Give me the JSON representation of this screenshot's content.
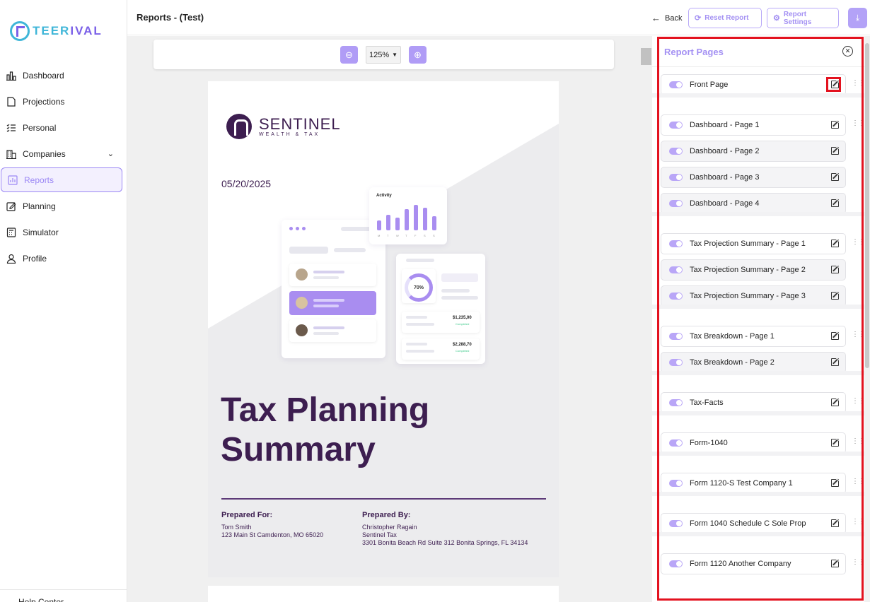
{
  "brand": {
    "name_a": "TEER",
    "name_b": "IVAL"
  },
  "sidebar": {
    "items": [
      {
        "label": "Dashboard",
        "icon": "bar-chart-icon"
      },
      {
        "label": "Projections",
        "icon": "document-icon"
      },
      {
        "label": "Personal",
        "icon": "checklist-icon"
      },
      {
        "label": "Companies",
        "icon": "building-icon"
      },
      {
        "label": "Reports",
        "icon": "report-chart-icon"
      },
      {
        "label": "Planning",
        "icon": "edit-document-icon"
      },
      {
        "label": "Simulator",
        "icon": "calculator-icon"
      },
      {
        "label": "Profile",
        "icon": "user-icon"
      }
    ],
    "active": "Reports",
    "help": "Help Center"
  },
  "header": {
    "title": "Reports - (Test)",
    "back": "Back",
    "reset": "Reset Report",
    "settings": "Report Settings"
  },
  "zoom": {
    "value": "125%"
  },
  "document": {
    "brand": "SENTINEL",
    "brand_sub": "WEALTH & TAX",
    "date": "05/20/2025",
    "title_line1": "Tax Planning",
    "title_line2": "Summary",
    "prepared_for": {
      "heading": "Prepared For:",
      "name": "Tom Smith",
      "address": "123 Main St Camdenton, MO 65020"
    },
    "prepared_by": {
      "heading": "Prepared By:",
      "name": "Christopher Ragain",
      "company": "Sentinel Tax",
      "address": "3301 Bonita Beach Rd Suite 312 Bonita Springs, FL 34134"
    },
    "illustration": {
      "activity_title": "Activity",
      "activity_days": [
        "M",
        "T",
        "W",
        "T",
        "F",
        "S",
        "S"
      ],
      "activity_values": [
        0.35,
        0.55,
        0.45,
        0.75,
        0.9,
        0.8,
        0.5
      ],
      "donut": "70%",
      "amount1": "$1,235,00",
      "amount2": "$2,288,70",
      "status1": "Completed",
      "status2": "Completed"
    }
  },
  "panel": {
    "title": "Report Pages",
    "groups": [
      [
        "Front Page"
      ],
      [
        "Dashboard - Page 1",
        "Dashboard - Page 2",
        "Dashboard - Page 3",
        "Dashboard - Page 4"
      ],
      [
        "Tax Projection Summary - Page 1",
        "Tax Projection Summary - Page 2",
        "Tax Projection Summary - Page 3"
      ],
      [
        "Tax Breakdown - Page 1",
        "Tax Breakdown - Page 2"
      ],
      [
        "Tax-Facts"
      ],
      [
        "Form-1040"
      ],
      [
        "Form 1120-S Test Company 1"
      ],
      [
        "Form 1040 Schedule C Sole Prop"
      ],
      [
        "Form 1120 Another Company"
      ]
    ]
  },
  "colors": {
    "accent": "#a491f3",
    "highlight": "#e3121f",
    "doc_brand": "#3d1e50"
  }
}
